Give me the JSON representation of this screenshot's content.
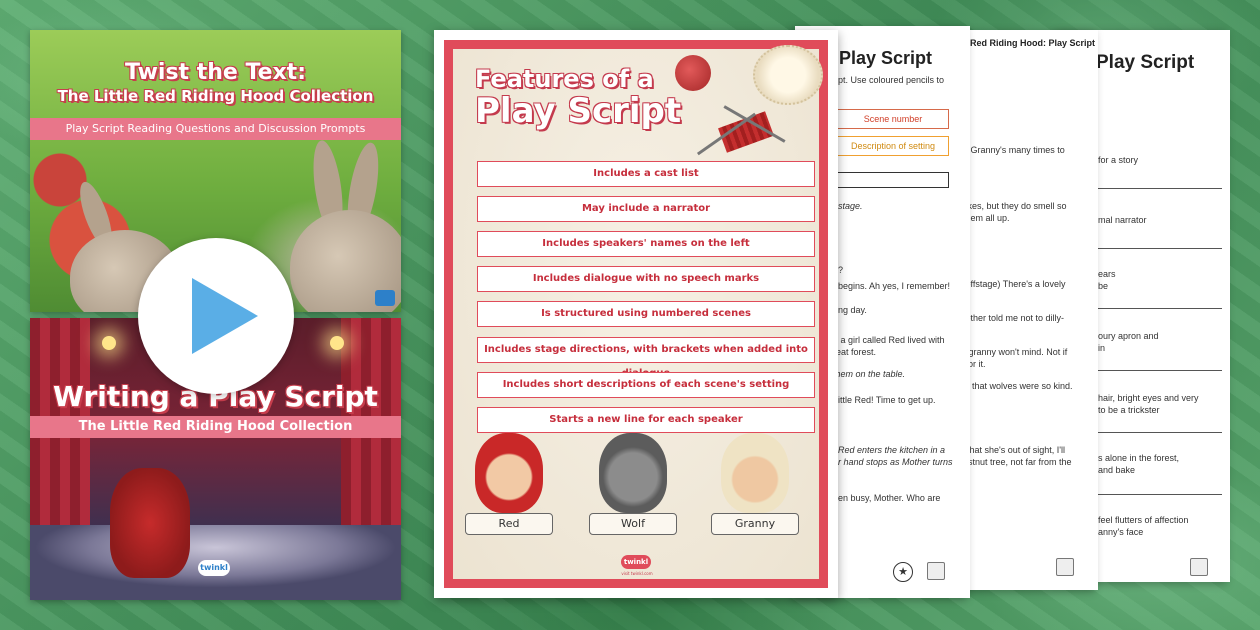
{
  "cover1": {
    "title_line1": "Twist the Text:",
    "title_line2": "The Little Red Riding Hood Collection",
    "subtitle": "Play Script Reading Questions and Discussion Prompts"
  },
  "cover2": {
    "title": "Writing a Play Script",
    "subtitle": "The Little Red Riding Hood Collection",
    "logo": "twinkl"
  },
  "play_button": {
    "icon": "play-icon",
    "color": "#5aaee6"
  },
  "poster": {
    "title_line1": "Features of a",
    "title_line2": "Play Script",
    "features": [
      "Includes a cast list",
      "May include a narrator",
      "Includes speakers' names on the left",
      "Includes dialogue with no speech marks",
      "Is structured using numbered scenes",
      "Includes stage directions, with brackets when added into dialogue",
      "Includes short descriptions of each scene's setting",
      "Starts a new line for each speaker"
    ],
    "characters": [
      "Red",
      "Wolf",
      "Granny"
    ],
    "logo": "twinkl",
    "url": "visit twinkl.com",
    "border_color": "#e04b5a"
  },
  "sheet1": {
    "title": "Play Script",
    "lines": [
      "ript. Use coloured pencils to",
      "nstage.",
      "d?",
      "t begins. Ah yes, I remember!",
      "ring day.",
      "– a girl called Red lived with",
      "reat forest.",
      "them on the table.",
      "Little Red! Time to get up.",
      ". Red enters the kitchen in a",
      "er hand stops as Mother turns",
      "een busy, Mother. Who are"
    ],
    "boxes": [
      "Scene number",
      "Description of setting",
      ""
    ]
  },
  "sheet2": {
    "title": "Red Riding Hood:  Play Script",
    "lines": [
      "ed Granny's many times to",
      "cakes, but they do smell so",
      "t them all up.",
      "g offstage) There's a lovely",
      "Mother told me not to dilly-",
      "ur granny won't mind. Not if",
      "p for it.",
      "ew that wolves were so kind.",
      "w that she's out of sight, I'll",
      "hestnut tree, not far from the"
    ]
  },
  "sheet3": {
    "title": "Play Script",
    "lines": [
      "for a story",
      "mal narrator",
      "ears",
      "be",
      "oury apron and",
      "in",
      "hair, bright eyes and very",
      "to be a trickster",
      "s alone in the forest,",
      "and bake",
      "feel flutters of affection",
      "anny's face"
    ]
  }
}
